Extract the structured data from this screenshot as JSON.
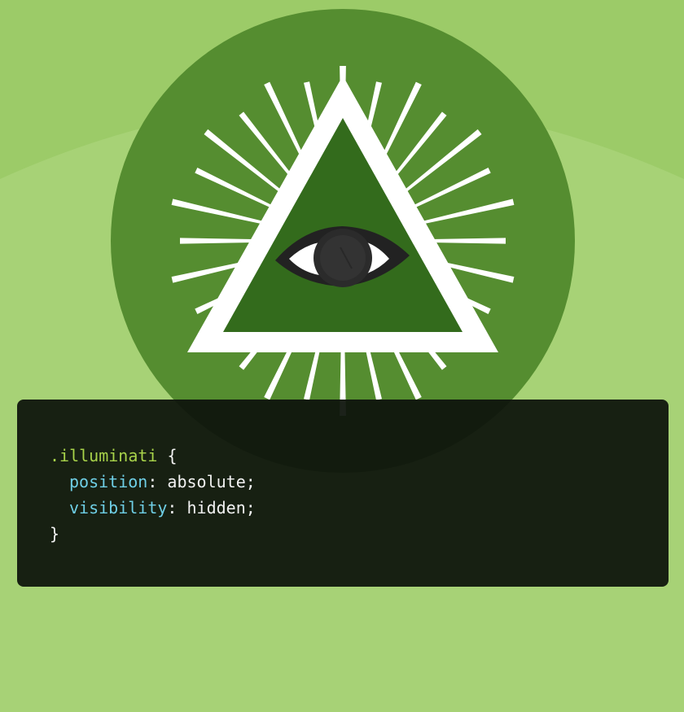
{
  "colors": {
    "page_background": "#a7d276",
    "top_band": "#9ccb68",
    "circle": "#558d30",
    "triangle_inner": "#336b1c",
    "triangle_border": "#ffffff",
    "eye_dark": "#222222",
    "code_card": "#161a13",
    "selector": "#a8d34a",
    "property": "#6fcfe6",
    "text": "#f2f2f2"
  },
  "illustration": {
    "icon": "all-seeing-eye-icon"
  },
  "code": {
    "selector": ".illuminati",
    "open_brace": " {",
    "lines": [
      {
        "property": "position",
        "colon": ": ",
        "value": "absolute;"
      },
      {
        "property": "visibility",
        "colon": ": ",
        "value": "hidden;"
      }
    ],
    "close_brace": "}"
  }
}
